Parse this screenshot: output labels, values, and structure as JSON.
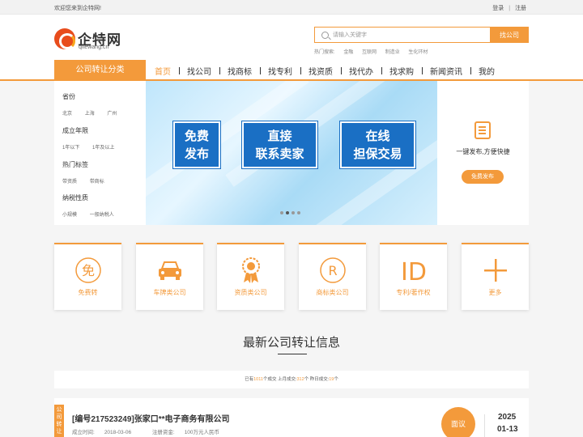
{
  "topbar": {
    "welcome": "欢迎您来到企特网!",
    "login": "登录",
    "separator": "|",
    "register": "注册"
  },
  "brand": {
    "name": "企特网",
    "domain": "qitewang.cn"
  },
  "search": {
    "placeholder": "请输入关键字",
    "button": "找公司"
  },
  "hot_search": {
    "label": "热门搜索:",
    "terms": [
      "金融",
      "互联网",
      "制造业",
      "生化环材"
    ]
  },
  "nav": {
    "category_button": "公司转让分类",
    "items": [
      "首页",
      "找公司",
      "找商标",
      "找专利",
      "找资质",
      "找代办",
      "找求购",
      "新闻资讯",
      "我的"
    ]
  },
  "filters": [
    {
      "title": "省份",
      "options": [
        "北京",
        "上海",
        "广州"
      ]
    },
    {
      "title": "成立年限",
      "options": [
        "1年以下",
        "1年及以上"
      ]
    },
    {
      "title": "热门标签",
      "options": [
        "带资质",
        "带商标"
      ]
    },
    {
      "title": "纳税性质",
      "options": [
        "小规模",
        "一般纳税人"
      ]
    }
  ],
  "banner": {
    "boxes": [
      {
        "line1": "免费",
        "line2": "发布"
      },
      {
        "line1": "直接",
        "line2": "联系卖家"
      },
      {
        "line1": "在线",
        "line2": "担保交易"
      }
    ],
    "active_slide": 2,
    "slide_count": 4
  },
  "publish_panel": {
    "icon": "document-edit-icon",
    "text": "一键发布,方便快捷",
    "button": "免费发布"
  },
  "categories": [
    {
      "label": "免费转",
      "icon": "free-badge-icon"
    },
    {
      "label": "车牌类公司",
      "icon": "car-icon"
    },
    {
      "label": "资质类公司",
      "icon": "award-ribbon-icon"
    },
    {
      "label": "商标类公司",
      "icon": "registered-trademark-icon"
    },
    {
      "label": "专利/著作权",
      "icon": "id-icon"
    },
    {
      "label": "更多",
      "icon": "plus-icon"
    }
  ],
  "section": {
    "title": "最新公司转让信息"
  },
  "stats": {
    "p1": "已有",
    "total": "1011",
    "p2": "个成交  上月成交:",
    "last_month": "312",
    "p3": "个  昨日成交:",
    "yesterday": "19",
    "p4": "个"
  },
  "listing": {
    "tag": "公司转让",
    "title": "[编号217523249]张家口**电子商务有限公司",
    "established_label": "成立时间:",
    "established": "2018-03-06",
    "capital_label": "注册资金:",
    "capital": "100万元人民币",
    "action": "面议",
    "year": "2025",
    "month_day": "01-13"
  },
  "colors": {
    "accent": "#f39a3b",
    "banner_box": "#1a6fc4",
    "logo_red": "#e84c1c"
  }
}
